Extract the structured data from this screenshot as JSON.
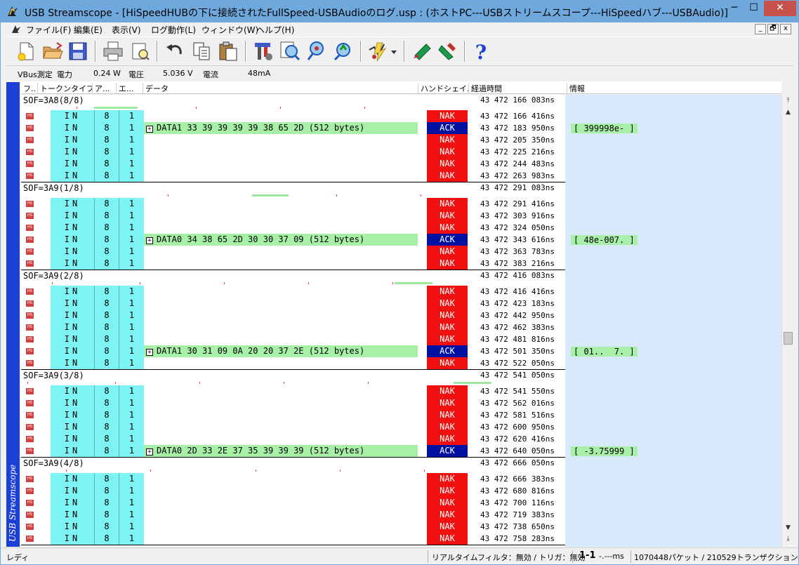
{
  "window": {
    "title": "USB Streamscope - [HiSpeedHUBの下に接続されたFullSpeed-USBAudioのログ.usp : (ホストPC---USBストリームスコープ---HiSpeedハブ---USBAudio)]",
    "min_glyph": "─",
    "max_glyph": "☐",
    "close_glyph": "✕"
  },
  "menu": {
    "items": [
      "ファイル(F)",
      "編集(E)",
      "表示(V)",
      "ログ動作(L)",
      "ウィンドウ(W)",
      "ヘルプ(H)"
    ],
    "mdi_min": "_",
    "mdi_restore": "🗗",
    "mdi_close": "x"
  },
  "toolbar": {
    "icons": [
      "new-icon",
      "open-icon",
      "save-icon",
      "print-icon",
      "print-preview-icon",
      "undo-icon",
      "copy-icon",
      "paste-icon",
      "settings-icon",
      "zoom-in-icon",
      "zoom-out-icon",
      "zoom-fit-icon",
      "trigger-icon",
      "marker-green-icon",
      "marker-red-icon",
      "help-icon"
    ],
    "help_glyph": "?"
  },
  "vbus": {
    "label": "VBus測定",
    "power_label": "電力",
    "power_value": "0.24",
    "power_unit": "W",
    "voltage_label": "電圧",
    "voltage_value": "5.036",
    "voltage_unit": "V",
    "current_label": "電流",
    "current_value": "48",
    "current_unit": "mA"
  },
  "sidebar": {
    "text": "USB Streamscope"
  },
  "columns": [
    "フ..",
    "トークンタイプ",
    "ア...",
    "エ...",
    "データ",
    "ハンドシェイ...",
    "経過時間",
    "情報"
  ],
  "hs_icon_text": "HS",
  "data_expander": "+",
  "sof_blocks": [
    {
      "label": "SOF=3A8(8/8)",
      "time": "43 472 166 083ns",
      "packets": [
        {
          "token": "IN",
          "addr": "8",
          "ep": "1",
          "data": "",
          "hs": "NAK",
          "time": "43 472 166 416ns",
          "info": ""
        },
        {
          "token": "IN",
          "addr": "8",
          "ep": "1",
          "data": "DATA1 33 39 39 39 39 38 65 2D (512 bytes)",
          "hs": "ACK",
          "time": "43 472 183 950ns",
          "info": "[ 399998e- ]"
        },
        {
          "token": "IN",
          "addr": "8",
          "ep": "1",
          "data": "",
          "hs": "NAK",
          "time": "43 472 205 350ns",
          "info": ""
        },
        {
          "token": "IN",
          "addr": "8",
          "ep": "1",
          "data": "",
          "hs": "NAK",
          "time": "43 472 225 216ns",
          "info": ""
        },
        {
          "token": "IN",
          "addr": "8",
          "ep": "1",
          "data": "",
          "hs": "NAK",
          "time": "43 472 244 483ns",
          "info": ""
        },
        {
          "token": "IN",
          "addr": "8",
          "ep": "1",
          "data": "",
          "hs": "NAK",
          "time": "43 472 263 983ns",
          "info": ""
        }
      ]
    },
    {
      "label": "SOF=3A9(1/8)",
      "time": "43 472 291 083ns",
      "packets": [
        {
          "token": "IN",
          "addr": "8",
          "ep": "1",
          "data": "",
          "hs": "NAK",
          "time": "43 472 291 416ns",
          "info": ""
        },
        {
          "token": "IN",
          "addr": "8",
          "ep": "1",
          "data": "",
          "hs": "NAK",
          "time": "43 472 303 916ns",
          "info": ""
        },
        {
          "token": "IN",
          "addr": "8",
          "ep": "1",
          "data": "",
          "hs": "NAK",
          "time": "43 472 324 050ns",
          "info": ""
        },
        {
          "token": "IN",
          "addr": "8",
          "ep": "1",
          "data": "DATA0 34 38 65 2D 30 30 37 09 (512 bytes)",
          "hs": "ACK",
          "time": "43 472 343 616ns",
          "info": "[ 48e-007. ]"
        },
        {
          "token": "IN",
          "addr": "8",
          "ep": "1",
          "data": "",
          "hs": "NAK",
          "time": "43 472 363 783ns",
          "info": ""
        },
        {
          "token": "IN",
          "addr": "8",
          "ep": "1",
          "data": "",
          "hs": "NAK",
          "time": "43 472 383 216ns",
          "info": ""
        }
      ]
    },
    {
      "label": "SOF=3A9(2/8)",
      "time": "43 472 416 083ns",
      "packets": [
        {
          "token": "IN",
          "addr": "8",
          "ep": "1",
          "data": "",
          "hs": "NAK",
          "time": "43 472 416 416ns",
          "info": ""
        },
        {
          "token": "IN",
          "addr": "8",
          "ep": "1",
          "data": "",
          "hs": "NAK",
          "time": "43 472 423 183ns",
          "info": ""
        },
        {
          "token": "IN",
          "addr": "8",
          "ep": "1",
          "data": "",
          "hs": "NAK",
          "time": "43 472 442 950ns",
          "info": ""
        },
        {
          "token": "IN",
          "addr": "8",
          "ep": "1",
          "data": "",
          "hs": "NAK",
          "time": "43 472 462 383ns",
          "info": ""
        },
        {
          "token": "IN",
          "addr": "8",
          "ep": "1",
          "data": "",
          "hs": "NAK",
          "time": "43 472 481 816ns",
          "info": ""
        },
        {
          "token": "IN",
          "addr": "8",
          "ep": "1",
          "data": "DATA1 30 31 09 0A 20 20 37 2E (512 bytes)",
          "hs": "ACK",
          "time": "43 472 501 350ns",
          "info": "[ 01..  7. ]"
        },
        {
          "token": "IN",
          "addr": "8",
          "ep": "1",
          "data": "",
          "hs": "NAK",
          "time": "43 472 522 050ns",
          "info": ""
        }
      ]
    },
    {
      "label": "SOF=3A9(3/8)",
      "time": "43 472 541 050ns",
      "packets": [
        {
          "token": "IN",
          "addr": "8",
          "ep": "1",
          "data": "",
          "hs": "NAK",
          "time": "43 472 541 550ns",
          "info": ""
        },
        {
          "token": "IN",
          "addr": "8",
          "ep": "1",
          "data": "",
          "hs": "NAK",
          "time": "43 472 562 016ns",
          "info": ""
        },
        {
          "token": "IN",
          "addr": "8",
          "ep": "1",
          "data": "",
          "hs": "NAK",
          "time": "43 472 581 516ns",
          "info": ""
        },
        {
          "token": "IN",
          "addr": "8",
          "ep": "1",
          "data": "",
          "hs": "NAK",
          "time": "43 472 600 950ns",
          "info": ""
        },
        {
          "token": "IN",
          "addr": "8",
          "ep": "1",
          "data": "",
          "hs": "NAK",
          "time": "43 472 620 416ns",
          "info": ""
        },
        {
          "token": "IN",
          "addr": "8",
          "ep": "1",
          "data": "DATA0 2D 33 2E 37 35 39 39 39 (512 bytes)",
          "hs": "ACK",
          "time": "43 472 640 050ns",
          "info": "[ -3.75999 ]"
        }
      ]
    },
    {
      "label": "SOF=3A9(4/8)",
      "time": "43 472 666 050ns",
      "packets": [
        {
          "token": "IN",
          "addr": "8",
          "ep": "1",
          "data": "",
          "hs": "NAK",
          "time": "43 472 666 383ns",
          "info": ""
        },
        {
          "token": "IN",
          "addr": "8",
          "ep": "1",
          "data": "",
          "hs": "NAK",
          "time": "43 472 680 816ns",
          "info": ""
        },
        {
          "token": "IN",
          "addr": "8",
          "ep": "1",
          "data": "",
          "hs": "NAK",
          "time": "43 472 700 116ns",
          "info": ""
        },
        {
          "token": "IN",
          "addr": "8",
          "ep": "1",
          "data": "",
          "hs": "NAK",
          "time": "43 472 719 383ns",
          "info": ""
        },
        {
          "token": "IN",
          "addr": "8",
          "ep": "1",
          "data": "",
          "hs": "NAK",
          "time": "43 472 738 650ns",
          "info": ""
        },
        {
          "token": "IN",
          "addr": "8",
          "ep": "1",
          "data": "",
          "hs": "NAK",
          "time": "43 472 758 283ns",
          "info": ""
        }
      ]
    }
  ],
  "scrollbar": {
    "top_glyph": "⤒",
    "up_glyph": "▲",
    "down_glyph": "▼",
    "bottom_glyph": "⤓"
  },
  "status": {
    "ready": "レディ",
    "filter": "リアルタイムフィルタ：無効 / トリガ：無効",
    "range": "1-1",
    "range_unit": "-.---ms",
    "counts": "1070448パケット / 210529トランザクション"
  },
  "colors": {
    "nak": "#f01010",
    "ack": "#0010a0",
    "token_bg": "#7ef3f3",
    "data_bg": "#a8f0a8",
    "info_col_bg": "#d8e9fb",
    "sidebar": "#1c3fd6"
  }
}
